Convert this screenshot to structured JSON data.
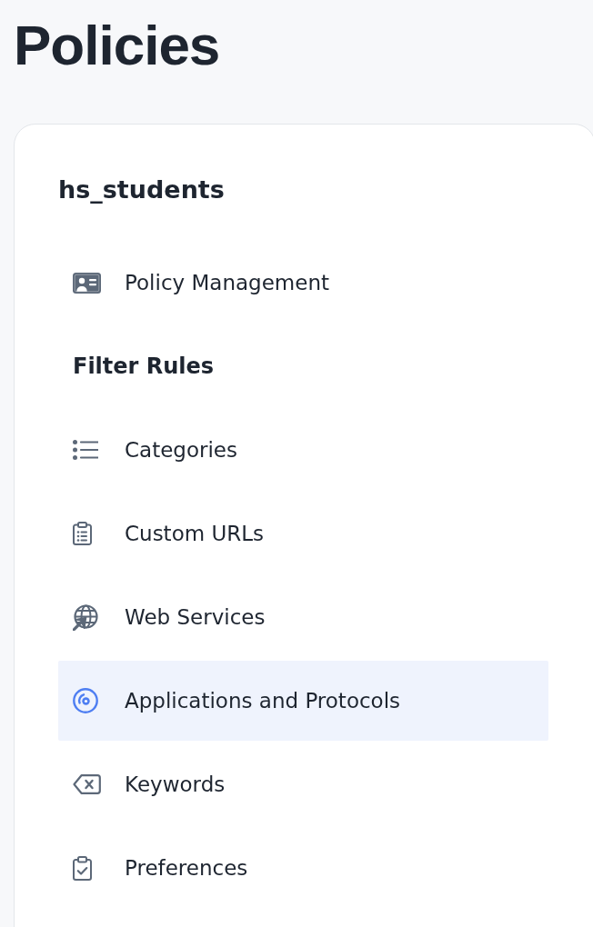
{
  "page": {
    "title": "Policies"
  },
  "policy": {
    "name": "hs_students",
    "nav": [
      {
        "label": "Policy Management",
        "selected": false
      }
    ],
    "sections": [
      {
        "heading": "Filter Rules",
        "items": [
          {
            "label": "Categories",
            "selected": false
          },
          {
            "label": "Custom URLs",
            "selected": false
          },
          {
            "label": "Web Services",
            "selected": false
          },
          {
            "label": "Applications and Protocols",
            "selected": true
          },
          {
            "label": "Keywords",
            "selected": false
          },
          {
            "label": "Preferences",
            "selected": false
          }
        ]
      }
    ]
  }
}
